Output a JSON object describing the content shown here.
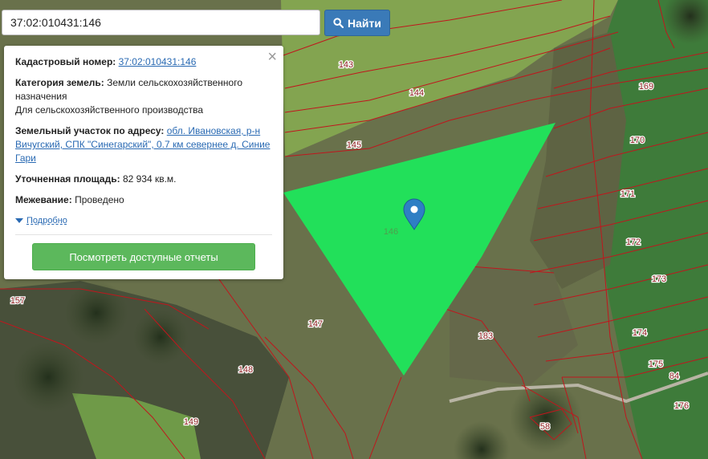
{
  "search": {
    "value": "37:02:010431:146",
    "button_label": "Найти"
  },
  "panel": {
    "cadastral_label": "Кадастровый номер:",
    "cadastral_value": "37:02:010431:146",
    "category_label": "Категория земель:",
    "category_value_1": "Земли сельскохозяйственного назначения",
    "category_value_2": "Для сельскохозяйственного производства",
    "address_label": "Земельный участок по адресу:",
    "address_value": "обл. Ивановская, р-н Вичугский, СПК \"Синегарский\", 0.7 км севернее д. Синие Гари",
    "area_label": "Уточненная площадь:",
    "area_value": "82 934 кв.м.",
    "survey_label": "Межевание:",
    "survey_value": "Проведено",
    "details_label": "Подробно",
    "reports_button": "Посмотреть доступные отчеты",
    "close_symbol": "×"
  },
  "parcels": [
    "143",
    "144",
    "145",
    "146",
    "147",
    "148",
    "149",
    "157",
    "169",
    "170",
    "171",
    "172",
    "173",
    "174",
    "175",
    "176",
    "183",
    "84",
    "58"
  ],
  "colors": {
    "selected_parcel": "#22e05a",
    "boundary": "#c0161d",
    "accent": "#3a7ab8",
    "reports": "#5cb85c"
  }
}
